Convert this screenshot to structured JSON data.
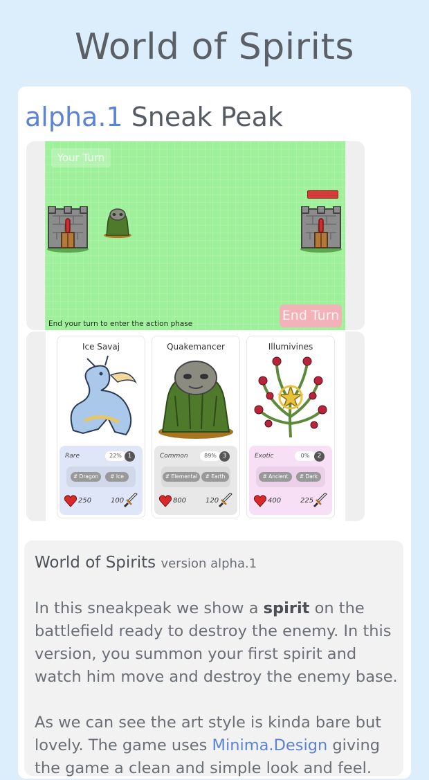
{
  "header": {
    "title": "World of Spirits"
  },
  "section": {
    "version": "alpha.1",
    "title": "Sneak Peak"
  },
  "game": {
    "turn_label": "Your Turn",
    "hint": "End your turn to enter the action phase",
    "end_turn_label": "End Turn",
    "board_color": "#9ef09a"
  },
  "cards": [
    {
      "name": "Ice Savaj",
      "rarity": "Rare",
      "percent": "22%",
      "count": "1",
      "tags": [
        "Dragon",
        "Ice"
      ],
      "hp": "250",
      "attack": "100",
      "color": "#dfe6f7",
      "art": "ice-dragon"
    },
    {
      "name": "Quakemancer",
      "rarity": "Common",
      "percent": "89%",
      "count": "3",
      "tags": [
        "Elemental",
        "Earth"
      ],
      "hp": "800",
      "attack": "120",
      "color": "#e8e8e8",
      "art": "rock-golem"
    },
    {
      "name": "Illumivines",
      "rarity": "Exotic",
      "percent": "0%",
      "count": "2",
      "tags": [
        "Ancient",
        "Dark"
      ],
      "hp": "400",
      "attack": "225",
      "color": "#f7dff5",
      "art": "rose-vines"
    }
  ],
  "info": {
    "heading_name": "World of Spirits",
    "heading_version": "version alpha.1",
    "p1_before": "In this sneakpeak we show a ",
    "p1_bold": "spirit",
    "p1_after": " on the battlefield ready to destroy the enemy. In this version, you summon your first spirit and watch him move and destroy the enemy base.",
    "p2_before": "As we can see the art style is kinda bare but lovely. The game uses ",
    "p2_link": "Minima.Design",
    "p2_after": " giving the game a clean and simple look and feel."
  }
}
